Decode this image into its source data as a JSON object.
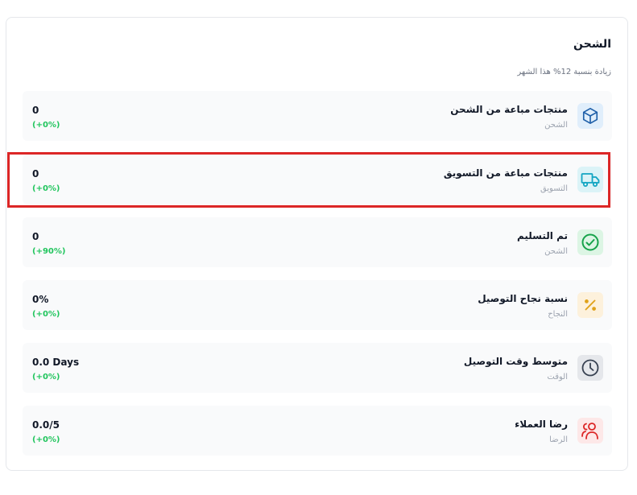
{
  "header": {
    "title": "الشحن",
    "subtitle": "زيادة بنسبة 12% هذا الشهر"
  },
  "colors": {
    "positive": "#22c55e",
    "highlight": "#dc2626"
  },
  "rows": [
    {
      "title": "منتجات مباعة من الشحن",
      "subtitle": "الشحن",
      "value": "0",
      "change": "(+0%)",
      "icon": "package-icon"
    },
    {
      "title": "منتجات مباعة من التسويق",
      "subtitle": "التسويق",
      "value": "0",
      "change": "(+0%)",
      "icon": "truck-icon"
    },
    {
      "title": "تم التسليم",
      "subtitle": "الشحن",
      "value": "0",
      "change": "(+90%)",
      "icon": "check-circle-icon"
    },
    {
      "title": "نسبة نجاح التوصيل",
      "subtitle": "النجاح",
      "value": "0%",
      "change": "(+0%)",
      "icon": "percent-icon"
    },
    {
      "title": "متوسط وقت التوصيل",
      "subtitle": "الوقت",
      "value": "0.0 Days",
      "change": "(+0%)",
      "icon": "clock-icon"
    },
    {
      "title": "رضا العملاء",
      "subtitle": "الرضا",
      "value": "0.0/5",
      "change": "(+0%)",
      "icon": "users-icon"
    }
  ]
}
